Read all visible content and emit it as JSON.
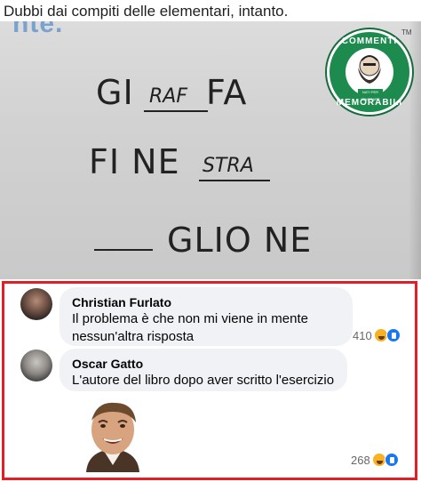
{
  "post": {
    "caption": "Dubbi dai compiti delle elementari, intanto."
  },
  "photo": {
    "worksheet_header_fragment": "nte.",
    "lines": [
      {
        "prefix": "GI",
        "filled": "RAF",
        "suffix": " FA"
      },
      {
        "prefix": "FI NE",
        "filled": "STRA",
        "suffix": ""
      },
      {
        "prefix": "",
        "filled": "",
        "suffix": "GLIO NE"
      }
    ]
  },
  "logo": {
    "top_text": "COMMENTI",
    "bottom_text": "MEMORABILI",
    "tag_text": "NATI PER IGNORARE",
    "trademark": "TM",
    "colors": {
      "green": "#1d8a4e"
    }
  },
  "comments": [
    {
      "author": "Christian Furlato",
      "text": "Il problema è che non mi viene in mente nessun'altra risposta",
      "reaction_count": "410",
      "reactions": [
        "haha-icon",
        "like-icon"
      ]
    },
    {
      "author": "Oscar Gatto",
      "text": "L'autore del libro dopo aver scritto l'esercizio",
      "sticker": "laughing-man-sticker",
      "reaction_count": "268",
      "reactions": [
        "haha-icon",
        "like-icon"
      ]
    }
  ],
  "colors": {
    "highlight_border": "#e31e24",
    "bubble_bg": "#f0f2f5",
    "like_blue": "#1877f2",
    "haha_yellow": "#f7b125"
  }
}
